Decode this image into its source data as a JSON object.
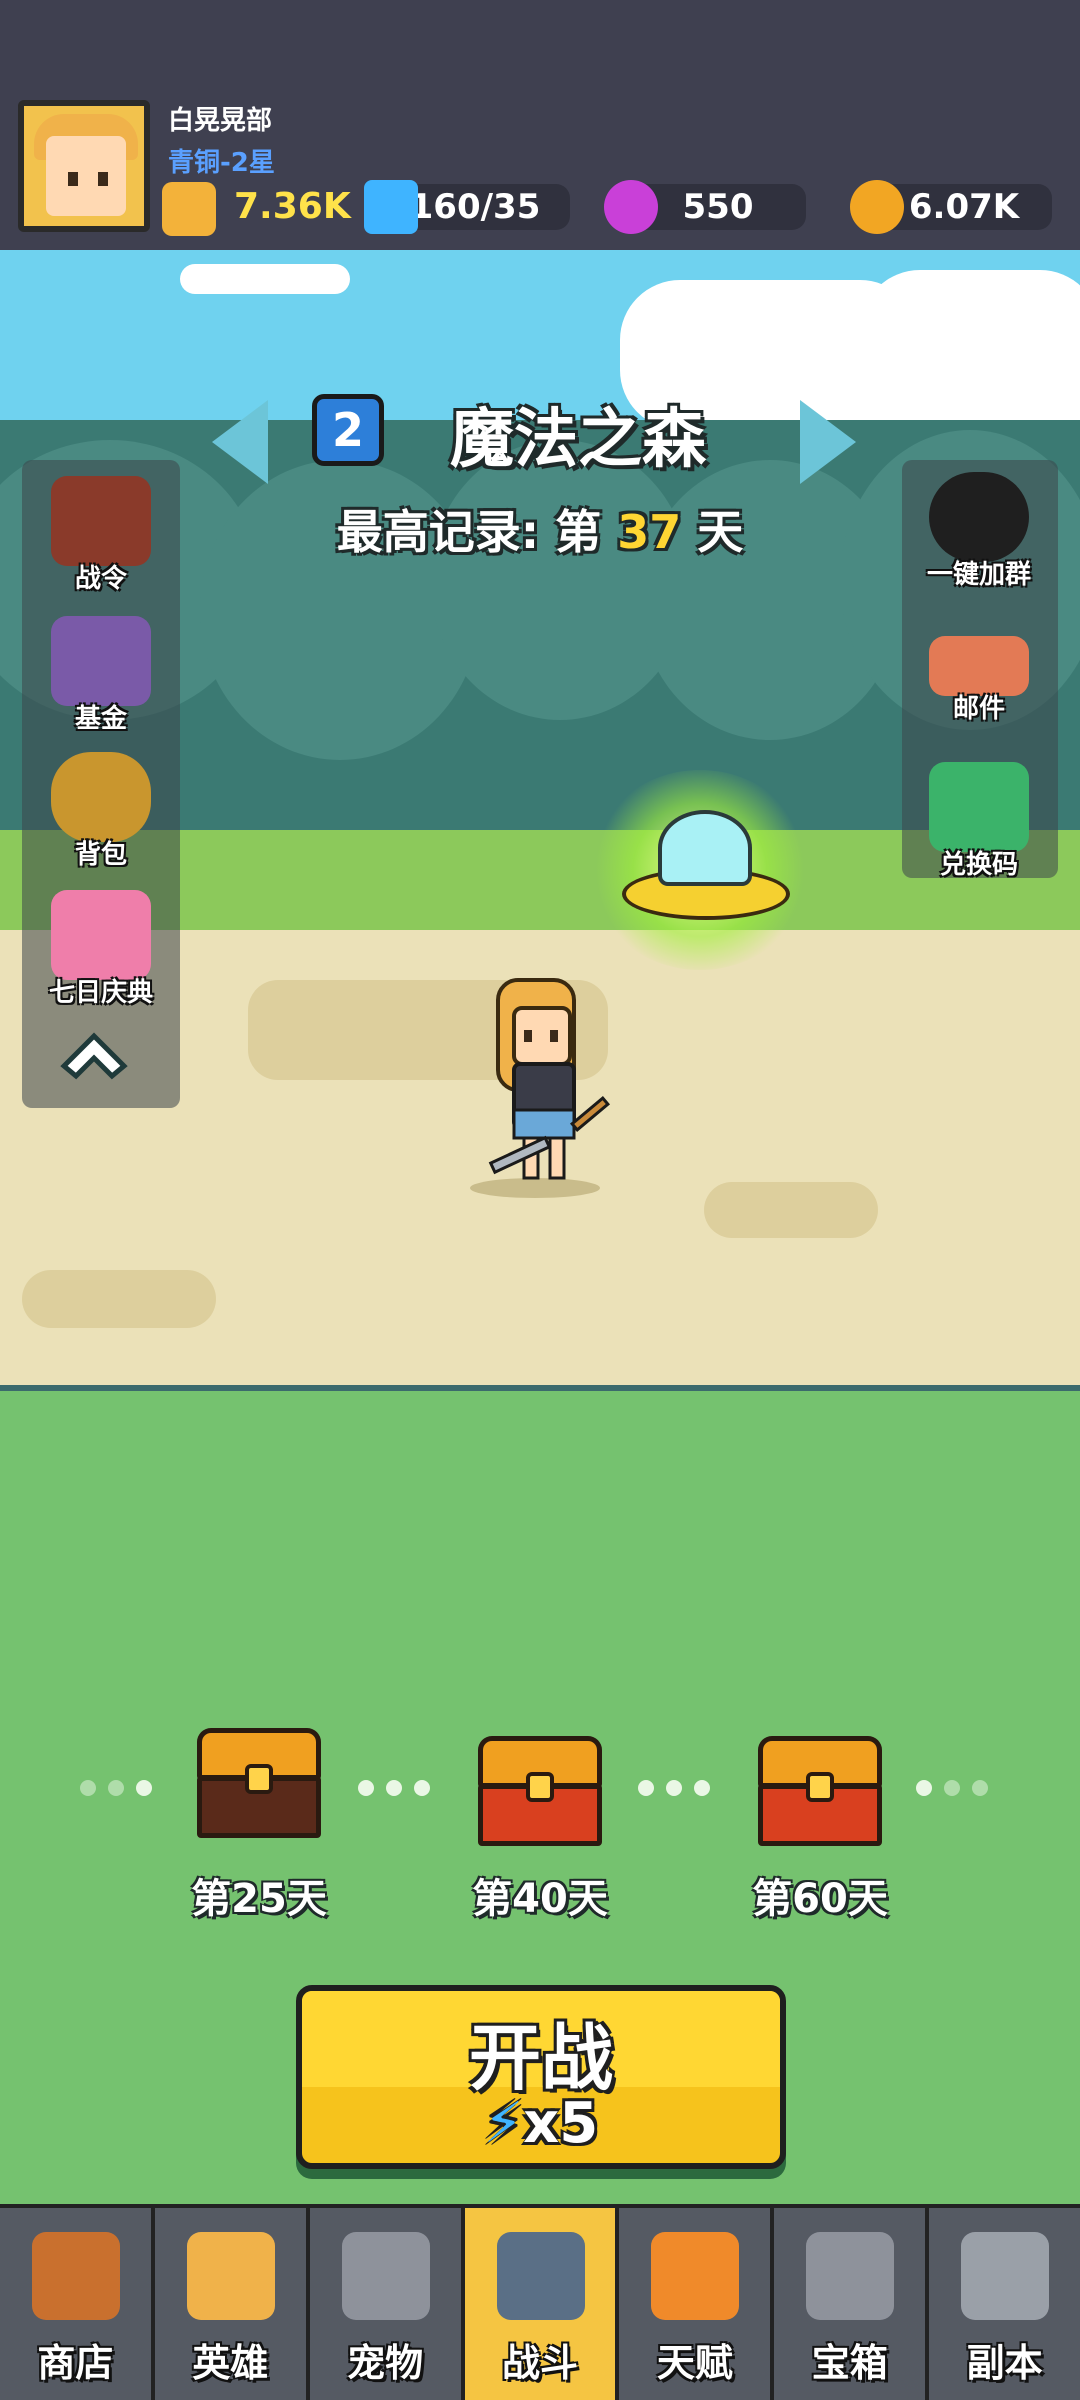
{
  "player": {
    "name": "白晃晃部",
    "rank": "青铜-2星",
    "power": "7.36K"
  },
  "resources": {
    "energy": "160/35",
    "gems": "550",
    "gold": "6.07K"
  },
  "level": {
    "number": "2",
    "name": "魔法之森",
    "record_prefix": "最高记录: 第",
    "record_day": "37",
    "record_suffix": "天"
  },
  "left_menu": [
    {
      "label": "战令",
      "icon": "battle-pass-banner-icon"
    },
    {
      "label": "基金",
      "icon": "fund-safe-icon"
    },
    {
      "label": "背包",
      "icon": "backpack-icon"
    },
    {
      "label": "七日庆典",
      "icon": "gift-box-icon"
    }
  ],
  "right_menu": [
    {
      "label": "一键加群",
      "icon": "qq-penguin-icon"
    },
    {
      "label": "邮件",
      "icon": "mail-scroll-icon"
    },
    {
      "label": "兑换码",
      "icon": "redeem-ticket-icon"
    }
  ],
  "milestones": [
    {
      "label": "第25天",
      "state": "opened"
    },
    {
      "label": "第40天",
      "state": "closed"
    },
    {
      "label": "第60天",
      "state": "closed"
    }
  ],
  "start_button": {
    "label": "开战",
    "cost": "x5"
  },
  "nav": [
    {
      "label": "商店",
      "icon": "shop-stall-icon",
      "active": false
    },
    {
      "label": "英雄",
      "icon": "hero-icon",
      "active": false
    },
    {
      "label": "宠物",
      "icon": "pet-rabbit-icon",
      "active": false
    },
    {
      "label": "战斗",
      "icon": "crossed-swords-icon",
      "active": true
    },
    {
      "label": "天赋",
      "icon": "talent-fist-icon",
      "active": false
    },
    {
      "label": "宝箱",
      "icon": "treasure-chest-icon",
      "active": false
    },
    {
      "label": "副本",
      "icon": "dungeon-map-icon",
      "active": false
    }
  ],
  "colors": {
    "header_bg": "#3f4050",
    "ground_green": "#75c26f",
    "start_yellow": "#f6c31c",
    "active_tab": "#f5c542"
  }
}
